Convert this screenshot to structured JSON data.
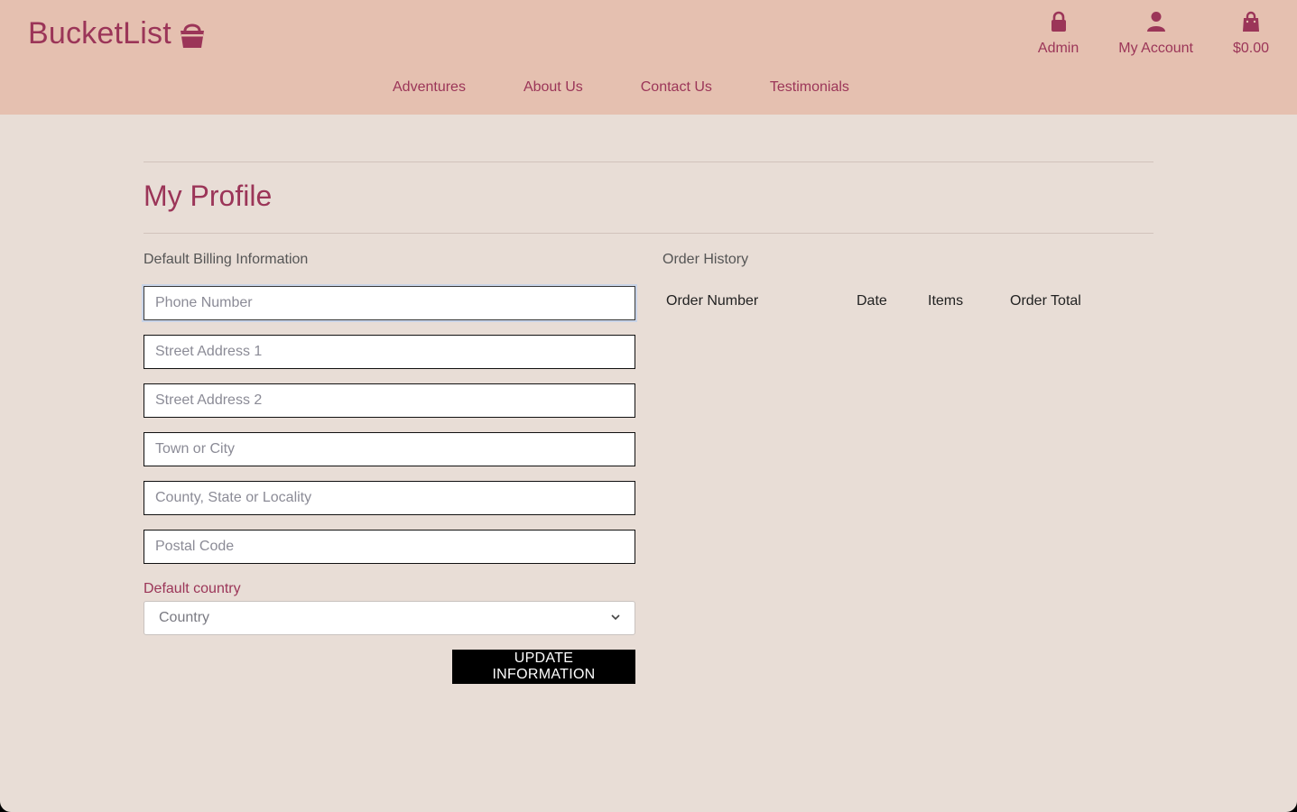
{
  "header": {
    "logo_text": "BucketList",
    "logo_icon": "basket-icon",
    "actions": [
      {
        "label": "Admin",
        "icon": "lock-icon"
      },
      {
        "label": "My Account",
        "icon": "user-icon"
      },
      {
        "label": "$0.00",
        "icon": "shopping-bag-icon"
      }
    ],
    "nav": [
      "Adventures",
      "About Us",
      "Contact Us",
      "Testimonials"
    ]
  },
  "main": {
    "title": "My Profile",
    "billing": {
      "heading": "Default Billing Information",
      "fields": [
        {
          "placeholder": "Phone Number",
          "value": ""
        },
        {
          "placeholder": "Street Address 1",
          "value": ""
        },
        {
          "placeholder": "Street Address 2",
          "value": ""
        },
        {
          "placeholder": "Town or City",
          "value": ""
        },
        {
          "placeholder": "County, State or Locality",
          "value": ""
        },
        {
          "placeholder": "Postal Code",
          "value": ""
        }
      ],
      "country_label": "Default country",
      "country_selected": "Country",
      "submit_label": "UPDATE INFORMATION"
    },
    "orders": {
      "heading": "Order History",
      "columns": [
        "Order Number",
        "Date",
        "Items",
        "Order Total"
      ],
      "rows": []
    }
  },
  "colors": {
    "header_bg": "#e5c0b0",
    "page_bg": "#e8ddd6",
    "accent": "#9b3558",
    "button_bg": "#000000"
  }
}
